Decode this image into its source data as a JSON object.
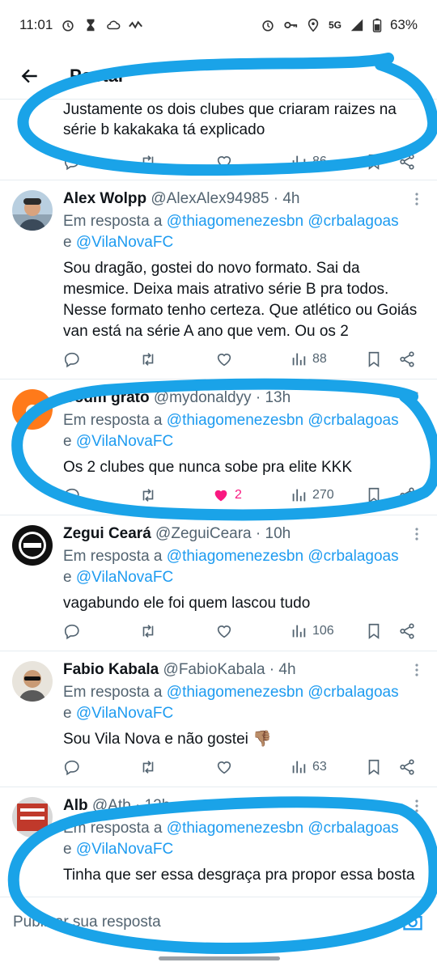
{
  "status_bar": {
    "time": "11:01",
    "network": "5G",
    "battery": "63%"
  },
  "header": {
    "title": "Postar"
  },
  "partial_tweet": {
    "text": "Justamente os dois clubes que criaram raizes na série b kakakaka tá explicado",
    "views": "86"
  },
  "tweets": [
    {
      "name": "Alex Wolpp",
      "handle": "@AlexAlex94985",
      "time": "4h",
      "reply_label": "Em resposta a",
      "mentions_line1": "@thiagomenezesbn @crbalagoas",
      "mentions_line2": "@VilaNovaFC",
      "conj": "e",
      "text": "Sou dragão, gostei do novo formato. Sai da mesmice. Deixa mais atrativo série B pra todos. Nesse formato tenho certeza. Que atlético ou Goiás van está na série A ano que vem. Ou os 2",
      "likes": "",
      "views": "88"
    },
    {
      "name": "Codm grato",
      "handle": "@mydonaldyy",
      "time": "13h",
      "reply_label": "Em resposta a",
      "mentions_line1": "@thiagomenezesbn @crbalagoas",
      "mentions_line2": "@VilaNovaFC",
      "conj": "e",
      "text": "Os 2 clubes que nunca sobe pra elite KKK",
      "likes": "2",
      "views": "270"
    },
    {
      "name": "Zegui Ceará",
      "handle": "@ZeguiCeara",
      "time": "10h",
      "reply_label": "Em resposta a",
      "mentions_line1": "@thiagomenezesbn @crbalagoas",
      "mentions_line2": "@VilaNovaFC",
      "conj": "e",
      "text": "vagabundo ele foi quem lascou tudo",
      "likes": "",
      "views": "106"
    },
    {
      "name": "Fabio Kabala",
      "handle": "@FabioKabala",
      "time": "4h",
      "reply_label": "Em resposta a",
      "mentions_line1": "@thiagomenezesbn @crbalagoas",
      "mentions_line2": "@VilaNovaFC",
      "conj": "e",
      "text": "Sou Vila Nova e não gostei 👎🏽",
      "likes": "",
      "views": "63"
    },
    {
      "name": "Alb",
      "handle": "@Atb",
      "time": "12h",
      "reply_label": "Em resposta a",
      "mentions_line1": "@thiagomenezesbn @crbalagoas",
      "mentions_line2": "@VilaNovaFC",
      "conj": "e",
      "text": "Tinha que ser essa desgraça pra propor essa bosta",
      "likes": "",
      "views": ""
    }
  ],
  "compose": {
    "placeholder": "Publicar sua resposta"
  },
  "colors": {
    "accent": "#1d9bf0",
    "like": "#f91880",
    "annotation": "#1aa3e8"
  }
}
